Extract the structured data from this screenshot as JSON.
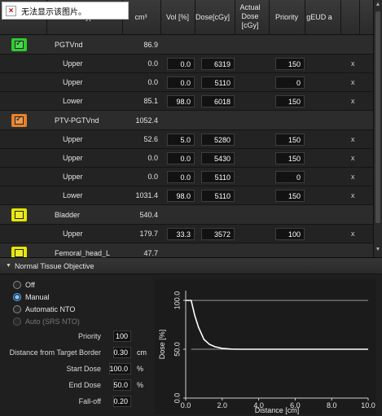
{
  "broken_image": {
    "text": "无法显示该图片。"
  },
  "header": {
    "id_type": "ID/Type",
    "cm3": "cm³",
    "vol": "Vol [%]",
    "dose": "Dose[cGy]",
    "actual_dose": "Actual Dose [cGy]",
    "priority": "Priority",
    "geud": "gEUD a"
  },
  "structures": [
    {
      "name": "PGTVnd",
      "volume": "86.9",
      "color": "#2ecc2e",
      "checked": true,
      "objectives": [
        {
          "type": "Upper",
          "cm3": "0.0",
          "vol": "0.0",
          "dose": "6319",
          "priority": "150",
          "remove": "x"
        },
        {
          "type": "Upper",
          "cm3": "0.0",
          "vol": "0.0",
          "dose": "5110",
          "priority": "0",
          "remove": "x"
        },
        {
          "type": "Lower",
          "cm3": "85.1",
          "vol": "98.0",
          "dose": "6018",
          "priority": "150",
          "remove": "x"
        }
      ]
    },
    {
      "name": "PTV-PGTVnd",
      "volume": "1052.4",
      "color": "#e8822a",
      "checked": true,
      "objectives": [
        {
          "type": "Upper",
          "cm3": "52.6",
          "vol": "5.0",
          "dose": "5280",
          "priority": "150",
          "remove": "x"
        },
        {
          "type": "Upper",
          "cm3": "0.0",
          "vol": "0.0",
          "dose": "5430",
          "priority": "150",
          "remove": "x"
        },
        {
          "type": "Upper",
          "cm3": "0.0",
          "vol": "0.0",
          "dose": "5110",
          "priority": "0",
          "remove": "x"
        },
        {
          "type": "Lower",
          "cm3": "1031.4",
          "vol": "98.0",
          "dose": "5110",
          "priority": "150",
          "remove": "x"
        }
      ]
    },
    {
      "name": "Bladder",
      "volume": "540.4",
      "color": "#e6e600",
      "checked": false,
      "objectives": [
        {
          "type": "Upper",
          "cm3": "179.7",
          "vol": "33.3",
          "dose": "3572",
          "priority": "100",
          "remove": "x"
        }
      ]
    },
    {
      "name": "Femoral_head_L",
      "volume": "47.7",
      "color": "#e6e600",
      "checked": false,
      "objectives": []
    }
  ],
  "nto": {
    "title": "Normal Tissue Objective",
    "modes": [
      {
        "label": "Off",
        "selected": false,
        "disabled": false
      },
      {
        "label": "Manual",
        "selected": true,
        "disabled": false
      },
      {
        "label": "Automatic NTO",
        "selected": false,
        "disabled": false
      },
      {
        "label": "Auto (SRS NTO)",
        "selected": false,
        "disabled": true
      }
    ],
    "fields": {
      "priority": {
        "label": "Priority",
        "value": "100",
        "unit": ""
      },
      "distance": {
        "label": "Distance from Target Border",
        "value": "0.30",
        "unit": "cm"
      },
      "start_dose": {
        "label": "Start Dose",
        "value": "100.0",
        "unit": "%"
      },
      "end_dose": {
        "label": "End Dose",
        "value": "50.0",
        "unit": "%"
      },
      "falloff": {
        "label": "Fall-off",
        "value": "0.20",
        "unit": ""
      }
    }
  },
  "chart_data": {
    "type": "line",
    "xlabel": "Distance [cm]",
    "ylabel": "Dose [%]",
    "xlim": [
      0,
      10
    ],
    "ylim": [
      0,
      110
    ],
    "xticks": [
      "0.0",
      "2.0",
      "4.0",
      "6.0",
      "8.0",
      "10.0"
    ],
    "yticks": [
      "0.0",
      "50.0",
      "100.0"
    ],
    "series": [
      {
        "line_color": "#ffffff",
        "x": [
          0.0,
          0.3,
          0.5,
          0.7,
          1.0,
          1.3,
          1.6,
          2.0,
          2.5,
          3.0,
          4.0,
          6.0,
          8.0,
          10.0
        ],
        "y": [
          100.0,
          100.0,
          84.3,
          72.5,
          60.1,
          55.0,
          52.6,
          50.9,
          50.2,
          50.0,
          50.0,
          50.0,
          50.0,
          50.0
        ]
      },
      {
        "line_color": "#9a9a9a",
        "x": [
          0.3,
          10.0
        ],
        "y": [
          100.0,
          100.0
        ]
      },
      {
        "line_color": "#9a9a9a",
        "x": [
          0.3,
          10.0
        ],
        "y": [
          50.0,
          50.0
        ]
      }
    ]
  }
}
